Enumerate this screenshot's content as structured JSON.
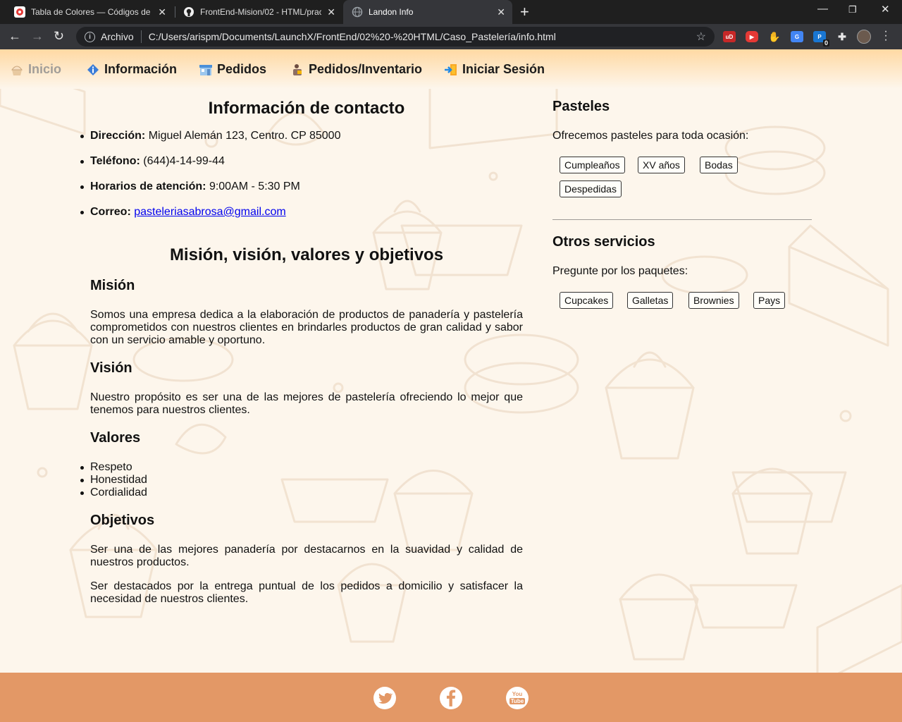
{
  "browser": {
    "tabs": [
      {
        "title": "Tabla de Colores — Códigos de C",
        "favicon": "red-circle-icon"
      },
      {
        "title": "FrontEnd-Mision/02 - HTML/prac",
        "favicon": "github-icon"
      },
      {
        "title": "Landon Info",
        "favicon": "globe-icon"
      }
    ],
    "scheme_label": "Archivo",
    "url": "C:/Users/arispm/Documents/LaunchX/FrontEnd/02%20-%20HTML/Caso_Pastelería/info.html",
    "extension_badge": "0"
  },
  "nav": {
    "items": [
      {
        "label": "Inicio"
      },
      {
        "label": "Información"
      },
      {
        "label": "Pedidos"
      },
      {
        "label": "Pedidos/Inventario"
      },
      {
        "label": "Iniciar Sesión"
      }
    ]
  },
  "contact": {
    "heading": "Información de contacto",
    "address_label": "Dirección:",
    "address_value": "Miguel Alemán 123, Centro. CP 85000",
    "phone_label": "Teléfono:",
    "phone_value": "(644)4-14-99-44",
    "hours_label": "Horarios de atención:",
    "hours_value": "9:00AM - 5:30 PM",
    "email_label": "Correo:",
    "email_value": "pasteleriasabrosa@gmail.com"
  },
  "mission": {
    "heading": "Misión, visión, valores y objetivos",
    "mision_title": "Misión",
    "mision_text": "Somos una empresa dedica a la elaboración de productos de panadería y pastelería comprometidos con nuestros clientes en brindarles productos de gran calidad y sabor con un servicio amable y oportuno.",
    "vision_title": "Visión",
    "vision_text": "Nuestro propósito es ser una de las mejores de pastelería ofreciendo lo mejor que tenemos para nuestros clientes.",
    "valores_title": "Valores",
    "valores": [
      "Respeto",
      "Honestidad",
      "Cordialidad"
    ],
    "objetivos_title": "Objetivos",
    "objetivo_1": "Ser una de las mejores panadería por destacarnos en la suavidad y calidad de nuestros productos.",
    "objetivo_2": "Ser destacados por la entrega puntual de los pedidos a domicilio y satisfacer la necesidad de nuestros clientes."
  },
  "sidebar": {
    "pasteles_title": "Pasteles",
    "pasteles_lead": "Ofrecemos pasteles para toda ocasión:",
    "pasteles_tags": [
      "Cumpleaños",
      "XV años",
      "Bodas",
      "Despedidas"
    ],
    "otros_title": "Otros servicios",
    "otros_lead": "Pregunte por los paquetes:",
    "otros_tags": [
      "Cupcakes",
      "Galletas",
      "Brownies",
      "Pays"
    ]
  },
  "footer": {
    "icons": [
      "twitter-icon",
      "facebook-icon",
      "youtube-icon"
    ],
    "youtube_text_top": "You",
    "youtube_text_bottom": "Tube"
  },
  "colors": {
    "page_bg": "#fdf6ec",
    "nav_gradient_top": "#ffd9a3",
    "footer_bg": "#e39866",
    "link": "#0000ee"
  }
}
